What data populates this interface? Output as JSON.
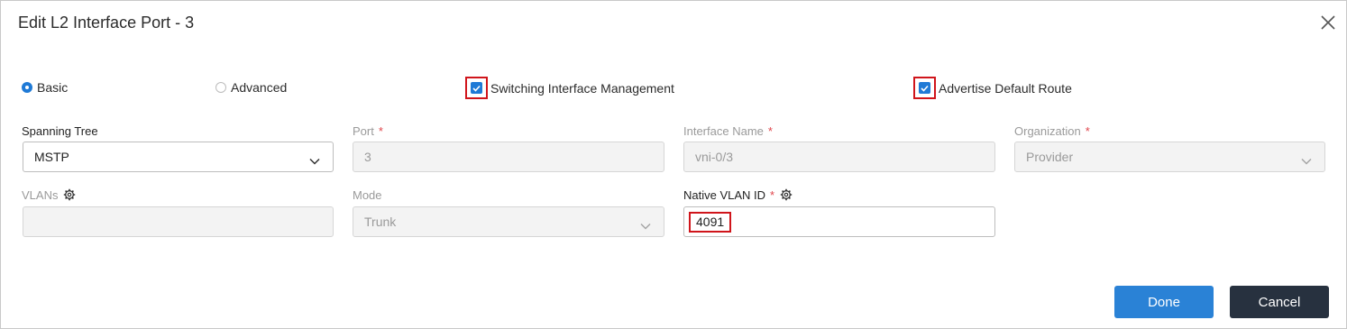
{
  "dialog": {
    "title": "Edit L2 Interface Port - 3"
  },
  "mode_options": [
    {
      "label": "Basic",
      "selected": true
    },
    {
      "label": "Advanced",
      "selected": false
    }
  ],
  "checkboxes": {
    "switching_interface_management": {
      "label": "Switching Interface Management",
      "checked": true
    },
    "advertise_default_route": {
      "label": "Advertise Default Route",
      "checked": true
    }
  },
  "fields": {
    "spanning_tree": {
      "label": "Spanning Tree",
      "value": "MSTP"
    },
    "port": {
      "label": "Port",
      "required_mark": "*",
      "value": "3"
    },
    "interface_name": {
      "label": "Interface Name",
      "required_mark": "*",
      "value": "vni-0/3"
    },
    "organization": {
      "label": "Organization",
      "required_mark": "*",
      "value": "Provider"
    },
    "vlans": {
      "label": "VLANs",
      "value": ""
    },
    "mode": {
      "label": "Mode",
      "value": "Trunk"
    },
    "native_vlan_id": {
      "label": "Native VLAN ID",
      "required_mark": "*",
      "value": "4091"
    }
  },
  "buttons": {
    "done": "Done",
    "cancel": "Cancel"
  },
  "colors": {
    "accent": "#1f7ad6",
    "highlight": "#d0151b",
    "done_button": "#2a82d6",
    "cancel_button": "#27313f"
  },
  "icons": [
    "close-icon",
    "gear-icon",
    "chevron-down-icon",
    "checkmark-icon"
  ]
}
